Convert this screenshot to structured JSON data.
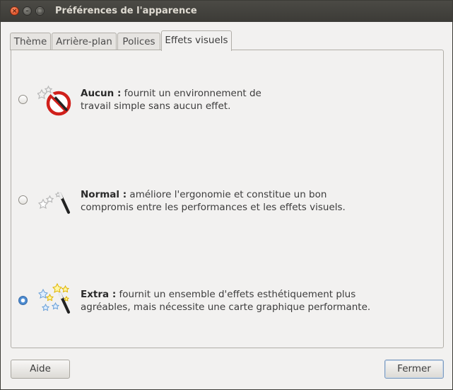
{
  "window": {
    "title": "Préférences de l'apparence"
  },
  "tabs": [
    {
      "label": "Thème"
    },
    {
      "label": "Arrière-plan"
    },
    {
      "label": "Polices"
    },
    {
      "label": "Effets visuels",
      "active": true
    }
  ],
  "options": [
    {
      "name": "Aucun :",
      "description": " fournit un environnement de",
      "description2": "travail simple sans aucun effet.",
      "selected": false,
      "icon": "no-effects-icon"
    },
    {
      "name": "Normal :",
      "description": " améliore l'ergonomie et constitue un bon",
      "description2": "compromis entre les performances et les effets visuels.",
      "selected": false,
      "icon": "magic-wand-icon"
    },
    {
      "name": "Extra :",
      "description": " fournit un ensemble d'effets esthétiquement plus",
      "description2": "agréables, mais nécessite une carte graphique performante.",
      "selected": true,
      "icon": "magic-wand-sparkles-icon"
    }
  ],
  "buttons": {
    "help": "Aide",
    "close": "Fermer"
  },
  "colors": {
    "titlebar": "#3c3b37",
    "accent": "#3a76c0",
    "close_button": "#e0522a"
  }
}
